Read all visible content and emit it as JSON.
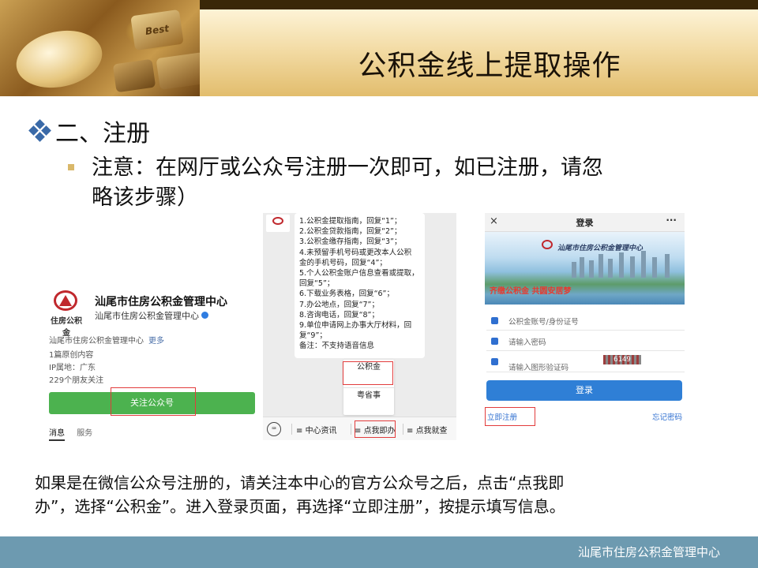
{
  "slide": {
    "title": "公积金线上提取操作",
    "section": "二、注册",
    "note_line1": "注意：在网厅或公众号注册一次即可，如已注册，请忽",
    "note_line2": "略该步骤）",
    "caption_line1": "如果是在微信公众号注册的，请关注本中心的官方公众号之后，点击“点我即",
    "caption_line2": "办”，选择“公积金”。进入登录页面，再选择“立即注册”，按提示填写信息。",
    "footer": "汕尾市住房公积金管理中心"
  },
  "header_image": {
    "key_label": "Best"
  },
  "account_profile": {
    "logo_text": "住房公积金",
    "name": "汕尾市住房公积金管理中心",
    "subtitle": "汕尾市住房公积金管理中心",
    "desc": "汕尾市住房公积金管理中心",
    "more": "更多",
    "original_count": "1篇原创内容",
    "ip": "IP属地：广东",
    "friends": "229个朋友关注",
    "follow_button": "关注公众号",
    "tab_messages": "消息",
    "tab_services": "服务",
    "accent_color": "#4cb24f"
  },
  "chat": {
    "lines": [
      "1.公积金提取指南，回复“1”；",
      "2.公积金贷款指南，回复“2”；",
      "3.公积金缴存指南，回复“3”；",
      "4.未预留手机号码或更改本人公积",
      "金的手机号码，回复“4”；",
      "5.个人公积金账户信息查看或提取，",
      "回复“5”；",
      "6.下载业务表格，回复“6”；",
      "7.办公地点，回复“7”；",
      "8.咨询电话，回复“8”；",
      "9.单位申请网上办事大厅材料，回",
      "复“9”；",
      "备注：不支持语音信息"
    ],
    "menu_items": [
      "公积金",
      "粤省事"
    ],
    "tabs": [
      "中心资讯",
      "点我即办",
      "点我就查"
    ],
    "keyboard_icon": "keyboard-icon"
  },
  "login": {
    "title": "登录",
    "close": "×",
    "more": "···",
    "banner_org": "汕尾市住房公积金管理中心",
    "banner_slogan": "齐缴公积金 共圆安居梦",
    "account_placeholder": "公积金账号/身份证号",
    "password_placeholder": "请输入密码",
    "captcha_placeholder": "请输入图形验证码",
    "captcha_text": "6149",
    "login_button": "登录",
    "register_link": "立即注册",
    "forgot_link": "忘记密码",
    "accent_color": "#2f7fd6"
  },
  "colors": {
    "highlight_box": "#e23c3c",
    "footer": "#6d9ab0",
    "bullet": "#d9b86a",
    "diamond": "#3a6aa8"
  }
}
